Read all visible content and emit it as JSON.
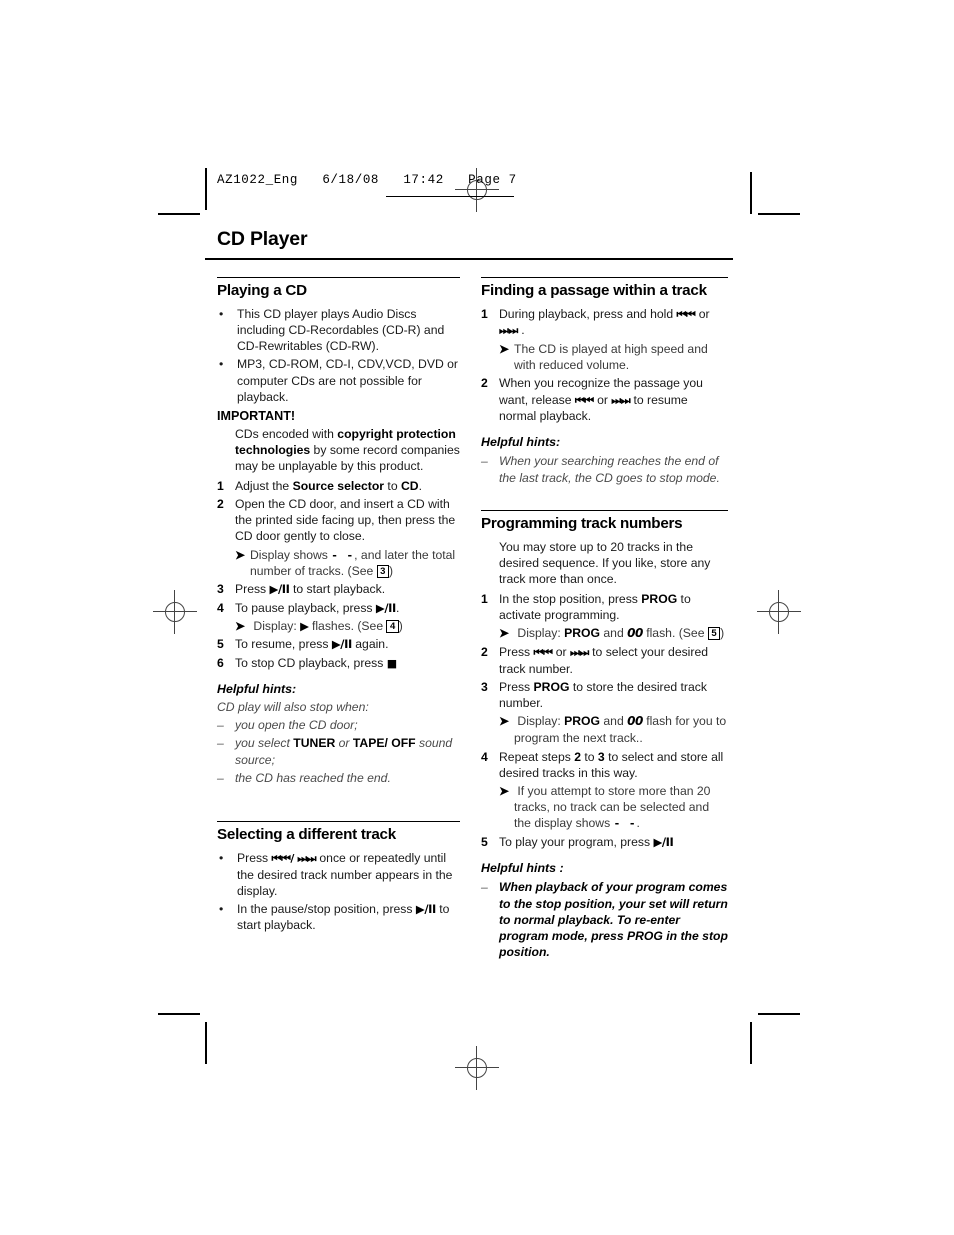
{
  "header": {
    "filename": "AZ1022_Eng",
    "date": "6/18/08",
    "time": "17:42",
    "page_label": "Page 7",
    "line": "AZ1022_Eng   6/18/08   17:42   Page 7"
  },
  "page_title": "CD Player",
  "left_column": {
    "playing": {
      "heading": "Playing a CD",
      "bullets": [
        "This CD player plays Audio Discs including CD-Recordables (CD-R) and CD-Rewritables (CD-RW).",
        "MP3, CD-ROM, CD-I, CDV,VCD, DVD or computer CDs are not possible for playback."
      ],
      "important_label": "IMPORTANT!",
      "important_pre": "CDs encoded with ",
      "important_bold": "copyright protection technologies",
      "important_post": " by some record companies may be unplayable by this product.",
      "steps": [
        {
          "n": "1",
          "pre": "Adjust the ",
          "bold1": "Source selector",
          "mid": " to ",
          "bold2": "CD",
          "post": "."
        },
        {
          "n": "2",
          "text": "Open the CD door, and insert a CD with the printed side facing up, then press the CD door gently to close.",
          "result_pre": "Display shows ",
          "result_glyph": "- -",
          "result_mid": ", and later the total number of tracks. (See ",
          "result_box": "3",
          "result_post": ")"
        },
        {
          "n": "3",
          "pre": "Press ",
          "glyph": "▶/II",
          "post": " to start playback."
        },
        {
          "n": "4",
          "pre": "To pause playback, press ",
          "glyph": "▶/II",
          "post": ".",
          "result_pre": "Display: ",
          "result_glyph": "▶",
          "result_mid": " flashes. (See ",
          "result_box": "4",
          "result_post": ")"
        },
        {
          "n": "5",
          "pre": "To resume, press ",
          "glyph": "▶/II",
          "post": " again."
        },
        {
          "n": "6",
          "pre": "To stop CD playback, press ",
          "glyph": "■",
          "post": ""
        }
      ],
      "hints_heading": "Helpful hints:",
      "hints_lead": "CD play will also stop when:",
      "hints": [
        {
          "pre": "you open the CD door;",
          "bold1": "",
          "mid": "",
          "bold2": "",
          "post": ""
        },
        {
          "pre": "you select ",
          "bold1": "TUNER",
          "mid": " or ",
          "bold2": "TAPE/ OFF",
          "post": " sound source;"
        },
        {
          "pre": "the CD has reached the end.",
          "bold1": "",
          "mid": "",
          "bold2": "",
          "post": ""
        }
      ]
    },
    "selecting": {
      "heading": "Selecting a different track",
      "bullets": [
        {
          "pre": "Press ",
          "glyph": "⏮⏮/ ⏭⏭",
          "post": " once or repeatedly until the desired track number appears in the display."
        },
        {
          "pre": "In the pause/stop position, press ",
          "glyph": "▶/II",
          "post": " to start playback."
        }
      ]
    }
  },
  "right_column": {
    "finding": {
      "heading": "Finding a passage within a track",
      "steps": [
        {
          "n": "1",
          "pre": "During playback, press and hold ",
          "glyph1": "⏮⏮",
          "mid": " or ",
          "glyph2": "⏭⏭",
          "post": " .",
          "result": "The CD is played at high speed and with reduced volume."
        },
        {
          "n": "2",
          "pre": "When you recognize the passage you want, release ",
          "glyph1": "⏮⏮",
          "mid": " or ",
          "glyph2": "⏭⏭",
          "post": " to resume normal playback."
        }
      ],
      "hints_heading": "Helpful hints:",
      "hints": [
        "When your searching reaches the end of the last track, the CD goes to stop mode."
      ]
    },
    "programming": {
      "heading": "Programming track  numbers",
      "intro": "You may store up to 20 tracks in the desired sequence. If you like, store any track more than once.",
      "steps": [
        {
          "n": "1",
          "pre": "In the stop position, press ",
          "bold1": "PROG",
          "post": " to activate programming.",
          "result_pre": "Display: ",
          "result_bold": "PROG",
          "result_mid": " and ",
          "result_lcd": "00",
          "result_mid2": "  flash. (See ",
          "result_box": "5",
          "result_post": ")"
        },
        {
          "n": "2",
          "pre": "Press ",
          "glyph1": "⏮⏮",
          "mid": " or ",
          "glyph2": "⏭⏭",
          "post": " to select your desired track number."
        },
        {
          "n": "3",
          "pre": "Press ",
          "bold1": "PROG",
          "post": " to store the desired track number.",
          "result_pre": "Display: ",
          "result_bold": "PROG",
          "result_mid": " and ",
          "result_lcd": "00",
          "result_mid2": " flash for you to program the next track..",
          "result_box": "",
          "result_post": ""
        },
        {
          "n": "4",
          "pre": "Repeat steps ",
          "bold1": "2",
          "mid": " to ",
          "bold2": "3",
          "post": " to select and store all desired tracks in this way.",
          "result_pre": "If you attempt to store more than 20 tracks, no track can be selected and the display shows ",
          "result_glyph": "- -",
          "result_post": "."
        },
        {
          "n": "5",
          "pre": "To play your program, press ",
          "glyph1": "▶/II",
          "post": ""
        }
      ],
      "hints_heading": "Helpful hints :",
      "hints": [
        "When playback of your program comes to the stop position, your set will return to normal playback. To re-enter program mode, press PROG in the stop position."
      ]
    }
  }
}
